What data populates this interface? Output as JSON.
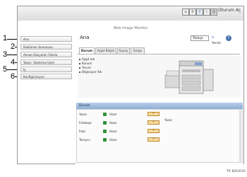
{
  "header": {
    "brand": "Web Image Monitor",
    "logout_label": "Oturum Aç",
    "icons": [
      "home-icon",
      "search-icon",
      "help-icon",
      "info-icon",
      "user-icon"
    ]
  },
  "callouts": [
    "1",
    "2",
    "3",
    "4",
    "5",
    "6"
  ],
  "sidebar": {
    "items": [
      {
        "label": "Ana"
      },
      {
        "label": "Doküman Sunucusu"
      },
      {
        "label": "Alınan Dosyaları Faksla"
      },
      {
        "label": "Yazıcı: Yazdırma İşleri"
      },
      {
        "label": "İş"
      },
      {
        "label": "Konfigürasyon"
      }
    ]
  },
  "main": {
    "title": "Ana",
    "language": "Türkçe",
    "refresh_label": "Yenile",
    "tabs": [
      {
        "label": "Durum"
      },
      {
        "label": "Aygıt Bilgisi"
      },
      {
        "label": "Sayaç"
      },
      {
        "label": "Sorgu"
      }
    ],
    "info": [
      "Aygıt adı",
      "Konum",
      "Yorum",
      "Bilgisayar Adı"
    ],
    "status_header": "Durum",
    "status_rows": [
      {
        "label": "Yazıcı",
        "value": "Hazır"
      },
      {
        "label": "Fotokopi",
        "value": "Hazır"
      },
      {
        "label": "Faks",
        "value": "Hazır"
      },
      {
        "label": "Tarayıcı",
        "value": "Hazır"
      }
    ],
    "right_status": "Yazıcı"
  },
  "figure_code": "TR BZU016"
}
